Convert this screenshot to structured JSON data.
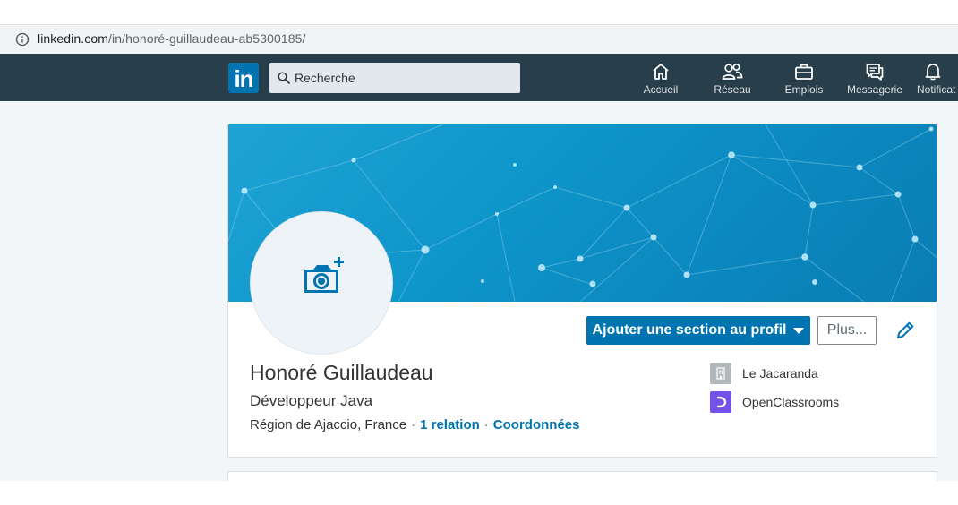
{
  "browser": {
    "url_host": "linkedin.com",
    "url_path": "/in/honoré-guillaudeau-ab5300185/"
  },
  "navbar": {
    "logo_text": "in",
    "search_placeholder": "Recherche",
    "items": [
      {
        "label": "Accueil",
        "icon": "home-icon"
      },
      {
        "label": "Réseau",
        "icon": "network-icon"
      },
      {
        "label": "Emplois",
        "icon": "jobs-icon"
      },
      {
        "label": "Messagerie",
        "icon": "messaging-icon"
      },
      {
        "label": "Notificat",
        "icon": "notifications-icon"
      }
    ],
    "colors": {
      "bar": "#283e4a",
      "brand": "#0073b1"
    }
  },
  "profile": {
    "name": "Honoré Guillaudeau",
    "headline": "Développeur Java",
    "location": "Région de Ajaccio, France",
    "separator": "·",
    "relations": "1 relation",
    "contact": "Coordonnées",
    "add_section_label": "Ajouter une section au profil",
    "more_label": "Plus...",
    "avatar_icon": "add-photo-camera-icon",
    "companies": [
      {
        "name": "Le Jacaranda",
        "icon": "company-building-icon"
      },
      {
        "name": "OpenClassrooms",
        "icon": "openclassrooms-logo-icon"
      }
    ]
  }
}
